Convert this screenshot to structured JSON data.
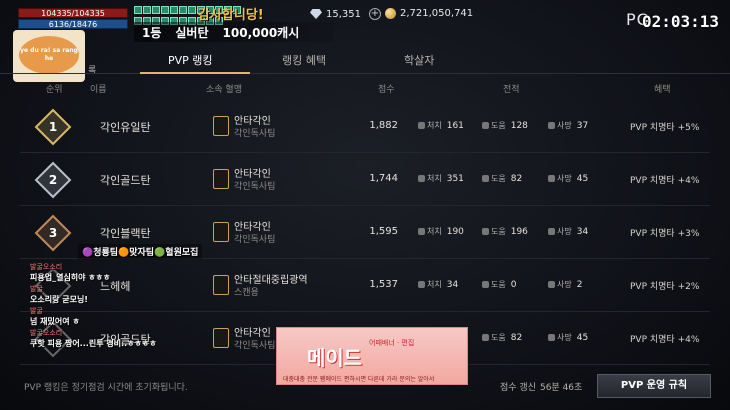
{
  "hud": {
    "hp_text": "104335/104335",
    "mp_text": "6136/18476",
    "overlay_title": "감사합니당!",
    "rank_label": "1등",
    "rank_name": "실버탄",
    "rank_cash": "100,000캐시",
    "diamonds": "15,351",
    "gold": "2,721,050,741",
    "timer": "02:03:13",
    "logo": "PC"
  },
  "bubble": {
    "text": "ye du ra! sa rang he",
    "tag": "록"
  },
  "tabs": [
    {
      "label": "PVP 랭킹",
      "active": true
    },
    {
      "label": "랭킹 혜택",
      "active": false
    },
    {
      "label": "학살자",
      "active": false
    }
  ],
  "columns": {
    "rank": "순위",
    "name": "이름",
    "guild": "소속 혈맹",
    "score": "점수",
    "record": "전적",
    "benefit": "혜택"
  },
  "rows": [
    {
      "rank": "1",
      "name": "각인유일탄",
      "guild": "안타각인",
      "sub": "각인독사팀",
      "score": "1,882",
      "kill_label": "처치",
      "kills": "161",
      "steal_label": "도움",
      "assists": "128",
      "death_label": "사망",
      "deaths": "37",
      "benefit": "PVP 치명타 +5%",
      "color": "#d9b86a"
    },
    {
      "rank": "2",
      "name": "각인골드탄",
      "guild": "안타각인",
      "sub": "각인독사팀",
      "score": "1,744",
      "kill_label": "처치",
      "kills": "351",
      "steal_label": "도움",
      "assists": "82",
      "death_label": "사망",
      "deaths": "45",
      "benefit": "PVP 치명타 +4%",
      "color": "#b8c0cc"
    },
    {
      "rank": "3",
      "name": "각인블랙탄",
      "guild": "안타각인",
      "sub": "각인독사팀",
      "score": "1,595",
      "kill_label": "처치",
      "kills": "190",
      "steal_label": "도움",
      "assists": "196",
      "death_label": "사망",
      "deaths": "34",
      "benefit": "PVP 치명타 +3%",
      "color": "#c08a5a"
    },
    {
      "rank": "",
      "name": "느헤헤",
      "guild": "안타절대중립광역",
      "sub": "스캔용",
      "score": "1,537",
      "kill_label": "처치",
      "kills": "34",
      "steal_label": "도움",
      "assists": "0",
      "death_label": "사망",
      "deaths": "2",
      "benefit": "PVP 치명타 +2%",
      "color": "#666"
    },
    {
      "rank": "",
      "name": "각인골드탄",
      "guild": "안타각인",
      "sub": "각인독사팀",
      "score": "",
      "kill_label": "",
      "kills": "",
      "steal_label": "도움",
      "assists": "82",
      "death_label": "사망",
      "deaths": "45",
      "benefit": "PVP 치명타 +4%",
      "color": "#666"
    }
  ],
  "guild_tags": "🟣청룡팀🟠맞자팀🟢혈원모집",
  "chat": [
    {
      "user": "발굴오소리",
      "msg": "피용업_열심히야 ㅎㅎㅎ"
    },
    {
      "user": "발굴",
      "msg": "오소리랑 굳모닝!"
    },
    {
      "user": "발굴",
      "msg": "넘 재밌어여 ㅎ"
    },
    {
      "user": "발굴오소리",
      "msg": "쿠핫 피용 짱어...린투 경비..ㅎㅎㅎㅎ"
    }
  ],
  "ad": {
    "title": "어때배너 · 편집",
    "big": "메이드",
    "desc": "대충대충 전문 팸메이드 편하시면 다른데 가라 문의는 알아서"
  },
  "footer": {
    "note": "PVP 랭킹은 정기점검 시간에 초기화됩니다.",
    "update_label": "점수 갱신",
    "update_time": "56분 46초",
    "rules_button": "PVP 운영 규칙"
  }
}
